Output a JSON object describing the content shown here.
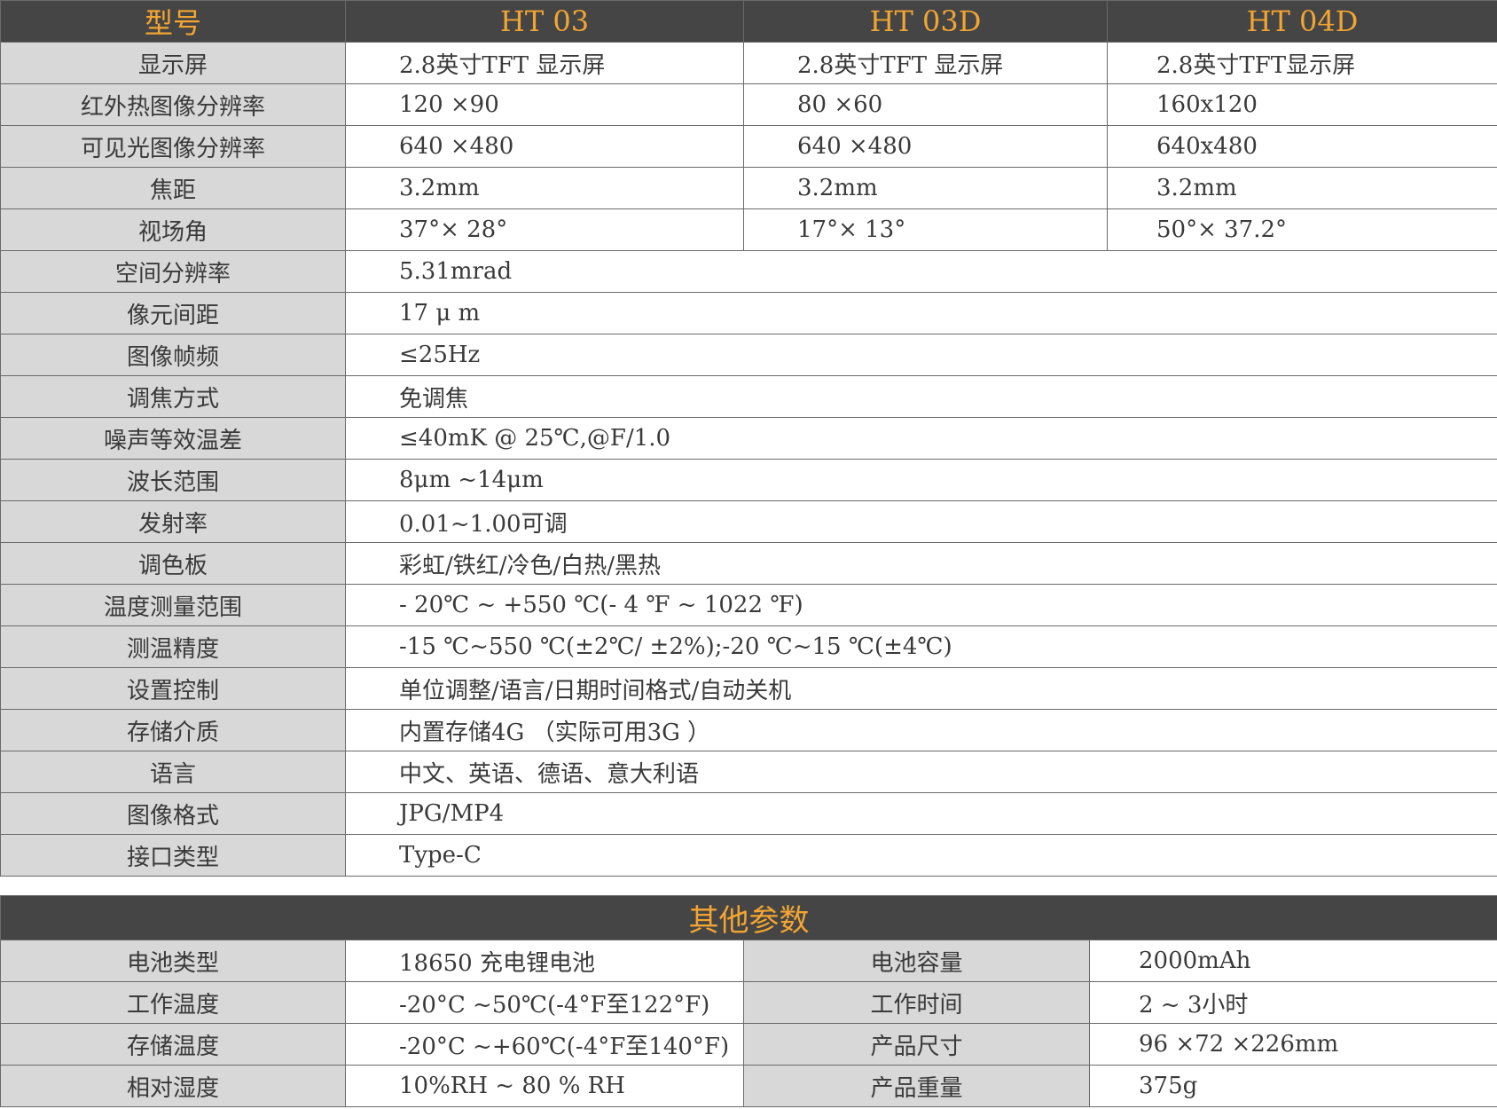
{
  "header": {
    "label": "型号",
    "models": [
      "HT 03",
      "HT 03D",
      "HT 04D"
    ]
  },
  "model_rows": [
    {
      "label": "显示屏",
      "values": [
        "2.8英寸TFT 显示屏",
        "2.8英寸TFT 显示屏",
        "2.8英寸TFT显示屏"
      ]
    },
    {
      "label": "红外热图像分辨率",
      "values": [
        "120 ×90",
        "80 ×60",
        "160x120"
      ]
    },
    {
      "label": "可见光图像分辨率",
      "values": [
        "640 ×480",
        "640 ×480",
        "640x480"
      ]
    },
    {
      "label": "焦距",
      "values": [
        "3.2mm",
        "3.2mm",
        "3.2mm"
      ]
    },
    {
      "label": "视场角",
      "values": [
        "37°× 28°",
        "17°× 13°",
        "50°× 37.2°"
      ]
    }
  ],
  "common_rows": [
    {
      "label": "空间分辨率",
      "value": "5.31mrad"
    },
    {
      "label": "像元间距",
      "value": "17 μ m"
    },
    {
      "label": "图像帧频",
      "value": "≤25Hz"
    },
    {
      "label": "调焦方式",
      "value": "免调焦"
    },
    {
      "label": "噪声等效温差",
      "value": "≤40mK @ 25℃,@F/1.0"
    },
    {
      "label": "波长范围",
      "value": "8μm ~14μm"
    },
    {
      "label": "发射率",
      "value": "0.01~1.00可调"
    },
    {
      "label": "调色板",
      "value": "彩虹/铁红/冷色/白热/黑热"
    },
    {
      "label": "温度测量范围",
      "value": "- 20℃ ~ +550 ℃(- 4 ℉ ~ 1022 ℉)"
    },
    {
      "label": "测温精度",
      "value": "-15 ℃~550 ℃(±2℃/ ±2%);-20 ℃~15 ℃(±4℃)"
    },
    {
      "label": "设置控制",
      "value": "单位调整/语言/日期时间格式/自动关机"
    },
    {
      "label": "存储介质",
      "value": "内置存储4G （实际可用3G ）"
    },
    {
      "label": "语言",
      "value": "中文、英语、德语、意大利语"
    },
    {
      "label": "图像格式",
      "value": "JPG/MP4"
    },
    {
      "label": "接口类型",
      "value": "Type-C"
    }
  ],
  "other_section": {
    "title": "其他参数",
    "rows": [
      {
        "label1": "电池类型",
        "value1": "18650 充电锂电池",
        "label2": "电池容量",
        "value2": "2000mAh"
      },
      {
        "label1": "工作温度",
        "value1": "-20°C ~50℃(-4°F至122°F)",
        "label2": "工作时间",
        "value2": "2 ~ 3小时"
      },
      {
        "label1": "存储温度",
        "value1": "-20°C ~+60℃(-4°F至140°F)",
        "label2": "产品尺寸",
        "value2": "96 ×72 ×226mm"
      },
      {
        "label1": "相对湿度",
        "value1": "10%RH ~ 80 % RH",
        "label2": "产品重量",
        "value2": "375g"
      }
    ]
  },
  "colors": {
    "header_bg": "#454545",
    "header_text": "#f3a531",
    "label_bg": "#d8d8d8",
    "value_bg": "#ffffff"
  }
}
